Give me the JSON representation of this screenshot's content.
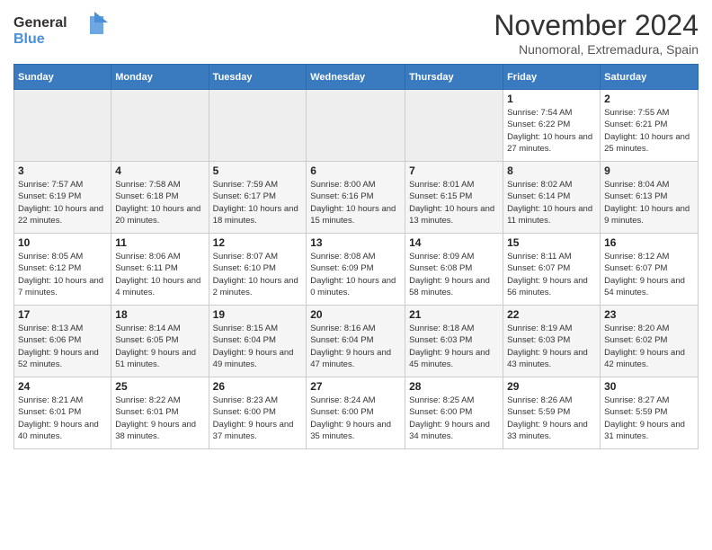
{
  "header": {
    "logo_line1": "General",
    "logo_line2": "Blue",
    "month": "November 2024",
    "location": "Nunomoral, Extremadura, Spain"
  },
  "weekdays": [
    "Sunday",
    "Monday",
    "Tuesday",
    "Wednesday",
    "Thursday",
    "Friday",
    "Saturday"
  ],
  "weeks": [
    [
      {
        "day": "",
        "info": ""
      },
      {
        "day": "",
        "info": ""
      },
      {
        "day": "",
        "info": ""
      },
      {
        "day": "",
        "info": ""
      },
      {
        "day": "",
        "info": ""
      },
      {
        "day": "1",
        "info": "Sunrise: 7:54 AM\nSunset: 6:22 PM\nDaylight: 10 hours and 27 minutes."
      },
      {
        "day": "2",
        "info": "Sunrise: 7:55 AM\nSunset: 6:21 PM\nDaylight: 10 hours and 25 minutes."
      }
    ],
    [
      {
        "day": "3",
        "info": "Sunrise: 7:57 AM\nSunset: 6:19 PM\nDaylight: 10 hours and 22 minutes."
      },
      {
        "day": "4",
        "info": "Sunrise: 7:58 AM\nSunset: 6:18 PM\nDaylight: 10 hours and 20 minutes."
      },
      {
        "day": "5",
        "info": "Sunrise: 7:59 AM\nSunset: 6:17 PM\nDaylight: 10 hours and 18 minutes."
      },
      {
        "day": "6",
        "info": "Sunrise: 8:00 AM\nSunset: 6:16 PM\nDaylight: 10 hours and 15 minutes."
      },
      {
        "day": "7",
        "info": "Sunrise: 8:01 AM\nSunset: 6:15 PM\nDaylight: 10 hours and 13 minutes."
      },
      {
        "day": "8",
        "info": "Sunrise: 8:02 AM\nSunset: 6:14 PM\nDaylight: 10 hours and 11 minutes."
      },
      {
        "day": "9",
        "info": "Sunrise: 8:04 AM\nSunset: 6:13 PM\nDaylight: 10 hours and 9 minutes."
      }
    ],
    [
      {
        "day": "10",
        "info": "Sunrise: 8:05 AM\nSunset: 6:12 PM\nDaylight: 10 hours and 7 minutes."
      },
      {
        "day": "11",
        "info": "Sunrise: 8:06 AM\nSunset: 6:11 PM\nDaylight: 10 hours and 4 minutes."
      },
      {
        "day": "12",
        "info": "Sunrise: 8:07 AM\nSunset: 6:10 PM\nDaylight: 10 hours and 2 minutes."
      },
      {
        "day": "13",
        "info": "Sunrise: 8:08 AM\nSunset: 6:09 PM\nDaylight: 10 hours and 0 minutes."
      },
      {
        "day": "14",
        "info": "Sunrise: 8:09 AM\nSunset: 6:08 PM\nDaylight: 9 hours and 58 minutes."
      },
      {
        "day": "15",
        "info": "Sunrise: 8:11 AM\nSunset: 6:07 PM\nDaylight: 9 hours and 56 minutes."
      },
      {
        "day": "16",
        "info": "Sunrise: 8:12 AM\nSunset: 6:07 PM\nDaylight: 9 hours and 54 minutes."
      }
    ],
    [
      {
        "day": "17",
        "info": "Sunrise: 8:13 AM\nSunset: 6:06 PM\nDaylight: 9 hours and 52 minutes."
      },
      {
        "day": "18",
        "info": "Sunrise: 8:14 AM\nSunset: 6:05 PM\nDaylight: 9 hours and 51 minutes."
      },
      {
        "day": "19",
        "info": "Sunrise: 8:15 AM\nSunset: 6:04 PM\nDaylight: 9 hours and 49 minutes."
      },
      {
        "day": "20",
        "info": "Sunrise: 8:16 AM\nSunset: 6:04 PM\nDaylight: 9 hours and 47 minutes."
      },
      {
        "day": "21",
        "info": "Sunrise: 8:18 AM\nSunset: 6:03 PM\nDaylight: 9 hours and 45 minutes."
      },
      {
        "day": "22",
        "info": "Sunrise: 8:19 AM\nSunset: 6:03 PM\nDaylight: 9 hours and 43 minutes."
      },
      {
        "day": "23",
        "info": "Sunrise: 8:20 AM\nSunset: 6:02 PM\nDaylight: 9 hours and 42 minutes."
      }
    ],
    [
      {
        "day": "24",
        "info": "Sunrise: 8:21 AM\nSunset: 6:01 PM\nDaylight: 9 hours and 40 minutes."
      },
      {
        "day": "25",
        "info": "Sunrise: 8:22 AM\nSunset: 6:01 PM\nDaylight: 9 hours and 38 minutes."
      },
      {
        "day": "26",
        "info": "Sunrise: 8:23 AM\nSunset: 6:00 PM\nDaylight: 9 hours and 37 minutes."
      },
      {
        "day": "27",
        "info": "Sunrise: 8:24 AM\nSunset: 6:00 PM\nDaylight: 9 hours and 35 minutes."
      },
      {
        "day": "28",
        "info": "Sunrise: 8:25 AM\nSunset: 6:00 PM\nDaylight: 9 hours and 34 minutes."
      },
      {
        "day": "29",
        "info": "Sunrise: 8:26 AM\nSunset: 5:59 PM\nDaylight: 9 hours and 33 minutes."
      },
      {
        "day": "30",
        "info": "Sunrise: 8:27 AM\nSunset: 5:59 PM\nDaylight: 9 hours and 31 minutes."
      }
    ]
  ]
}
